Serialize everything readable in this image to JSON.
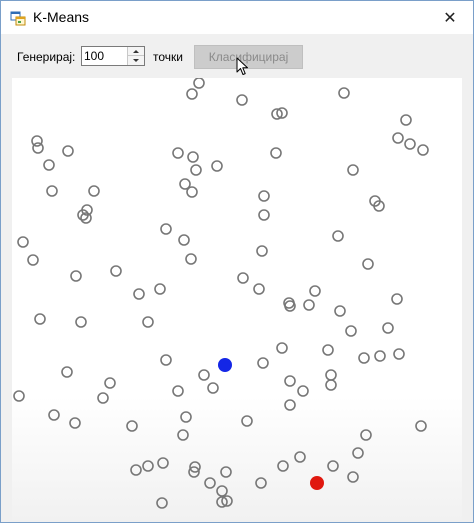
{
  "window": {
    "title": "K-Means",
    "close_glyph": "✕"
  },
  "toolbar": {
    "generate_label": "Генерирај:",
    "points_value": "100",
    "points_label": "точки",
    "classify_label": "Класифицирај",
    "classify_enabled": false
  },
  "icons": {
    "app": "app-window-icon",
    "close": "close-icon",
    "spin_up": "chevron-up-icon",
    "spin_down": "chevron-down-icon",
    "cursor": "mouse-pointer-icon"
  },
  "colors": {
    "point_stroke": "#777777",
    "centroid_blue": "#1426e6",
    "centroid_red": "#e0180f",
    "button_disabled_bg": "#cccccc"
  },
  "chart_data": {
    "type": "scatter",
    "title": "",
    "xlim": [
      0,
      450
    ],
    "ylim": [
      0,
      442
    ],
    "y_axis_direction": "down",
    "grid": false,
    "series": [
      {
        "role": "points",
        "marker": "hollow-circle",
        "points": [
          [
            187,
            5
          ],
          [
            180,
            16
          ],
          [
            230,
            22
          ],
          [
            332,
            15
          ],
          [
            265,
            36
          ],
          [
            270,
            35
          ],
          [
            394,
            42
          ],
          [
            386,
            60
          ],
          [
            398,
            66
          ],
          [
            411,
            72
          ],
          [
            25,
            63
          ],
          [
            26,
            70
          ],
          [
            56,
            73
          ],
          [
            37,
            87
          ],
          [
            166,
            75
          ],
          [
            181,
            79
          ],
          [
            205,
            88
          ],
          [
            184,
            92
          ],
          [
            264,
            75
          ],
          [
            341,
            92
          ],
          [
            40,
            113
          ],
          [
            82,
            113
          ],
          [
            173,
            106
          ],
          [
            180,
            114
          ],
          [
            252,
            118
          ],
          [
            363,
            123
          ],
          [
            367,
            128
          ],
          [
            75,
            132
          ],
          [
            71,
            137
          ],
          [
            74,
            140
          ],
          [
            252,
            137
          ],
          [
            154,
            151
          ],
          [
            172,
            162
          ],
          [
            326,
            158
          ],
          [
            11,
            164
          ],
          [
            21,
            182
          ],
          [
            179,
            181
          ],
          [
            250,
            173
          ],
          [
            356,
            186
          ],
          [
            104,
            193
          ],
          [
            64,
            198
          ],
          [
            231,
            200
          ],
          [
            247,
            211
          ],
          [
            127,
            216
          ],
          [
            148,
            211
          ],
          [
            277,
            225
          ],
          [
            303,
            213
          ],
          [
            385,
            221
          ],
          [
            278,
            228
          ],
          [
            297,
            227
          ],
          [
            28,
            241
          ],
          [
            69,
            244
          ],
          [
            136,
            244
          ],
          [
            328,
            233
          ],
          [
            339,
            253
          ],
          [
            376,
            250
          ],
          [
            270,
            270
          ],
          [
            316,
            272
          ],
          [
            352,
            280
          ],
          [
            368,
            278
          ],
          [
            154,
            282
          ],
          [
            251,
            285
          ],
          [
            387,
            276
          ],
          [
            55,
            294
          ],
          [
            98,
            305
          ],
          [
            192,
            297
          ],
          [
            201,
            310
          ],
          [
            278,
            303
          ],
          [
            319,
            297
          ],
          [
            319,
            307
          ],
          [
            7,
            318
          ],
          [
            91,
            320
          ],
          [
            166,
            313
          ],
          [
            291,
            313
          ],
          [
            278,
            327
          ],
          [
            42,
            337
          ],
          [
            63,
            345
          ],
          [
            174,
            339
          ],
          [
            235,
            343
          ],
          [
            409,
            348
          ],
          [
            120,
            348
          ],
          [
            171,
            357
          ],
          [
            354,
            357
          ],
          [
            346,
            375
          ],
          [
            288,
            379
          ],
          [
            271,
            388
          ],
          [
            321,
            388
          ],
          [
            124,
            392
          ],
          [
            136,
            388
          ],
          [
            151,
            385
          ],
          [
            182,
            394
          ],
          [
            198,
            405
          ],
          [
            210,
            413
          ],
          [
            214,
            394
          ],
          [
            249,
            405
          ],
          [
            341,
            399
          ],
          [
            210,
            424
          ],
          [
            215,
            423
          ],
          [
            150,
            425
          ],
          [
            183,
            389
          ]
        ]
      },
      {
        "role": "centroids",
        "marker": "filled-circle",
        "points": [
          {
            "x": 213,
            "y": 287,
            "color": "blue"
          },
          {
            "x": 305,
            "y": 405,
            "color": "red"
          }
        ]
      }
    ]
  }
}
